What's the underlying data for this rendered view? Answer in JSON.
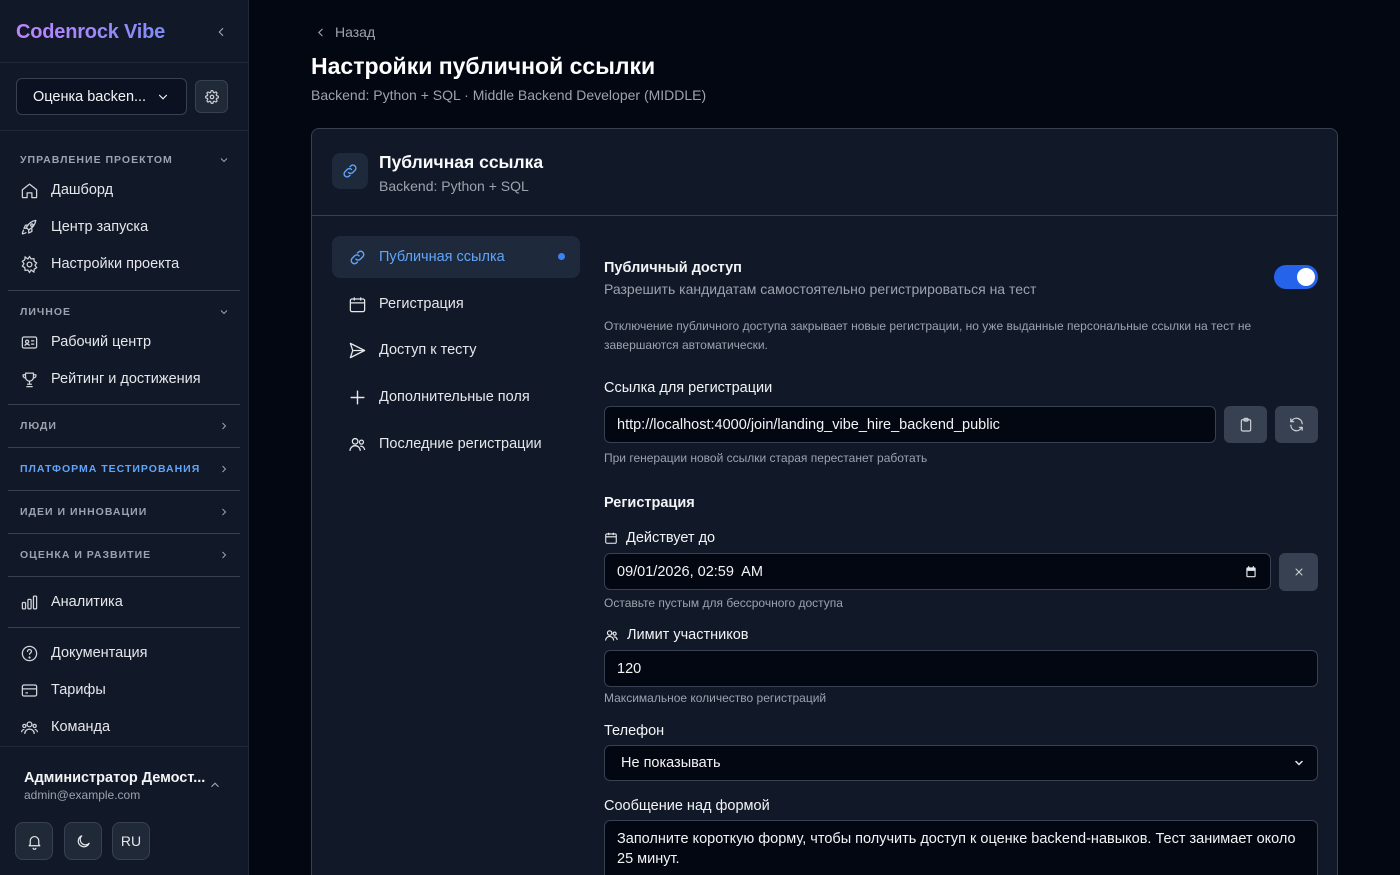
{
  "app": {
    "brand": "Codenrock Vibe"
  },
  "project_selector": {
    "value": "Оценка backen..."
  },
  "sidebar": {
    "section_project": "УПРАВЛЕНИЕ ПРОЕКТОМ",
    "project_items": [
      {
        "label": "Дашборд",
        "icon": "home-icon"
      },
      {
        "label": "Центр запуска",
        "icon": "rocket-icon"
      },
      {
        "label": "Настройки проекта",
        "icon": "gear-icon"
      }
    ],
    "section_personal": "ЛИЧНОЕ",
    "personal_items": [
      {
        "label": "Рабочий центр",
        "icon": "id-card-icon"
      },
      {
        "label": "Рейтинг и достижения",
        "icon": "trophy-icon"
      }
    ],
    "section_people": "ЛЮДИ",
    "section_testing": "ПЛАТФОРМА ТЕСТИРОВАНИЯ",
    "section_ideas": "ИДЕИ И ИННОВАЦИИ",
    "section_assessment": "ОЦЕНКА И РАЗВИТИЕ",
    "analytics": "Аналитика",
    "bottom_items": [
      {
        "label": "Документация",
        "icon": "help-circle-icon"
      },
      {
        "label": "Тарифы",
        "icon": "credit-card-icon"
      },
      {
        "label": "Команда",
        "icon": "users-icon"
      }
    ],
    "active_section_color": "#60a5fa"
  },
  "user": {
    "name": "Администратор Демост...",
    "email": "admin@example.com"
  },
  "footer_buttons": {
    "lang": "RU"
  },
  "header": {
    "back": "Назад",
    "title": "Настройки публичной ссылки",
    "subtitle": "Backend: Python + SQL · Middle Backend Developer (MIDDLE)"
  },
  "card": {
    "title": "Публичная ссылка",
    "subtitle": "Backend: Python + SQL"
  },
  "tabs": [
    {
      "label": "Публичная ссылка",
      "icon": "link-icon",
      "active": true
    },
    {
      "label": "Регистрация",
      "icon": "calendar-icon",
      "active": false
    },
    {
      "label": "Доступ к тесту",
      "icon": "send-icon",
      "active": false
    },
    {
      "label": "Дополнительные поля",
      "icon": "plus-icon",
      "active": false
    },
    {
      "label": "Последние регистрации",
      "icon": "users-icon",
      "active": false
    }
  ],
  "form": {
    "public_access_label": "Публичный доступ",
    "public_access_desc": "Разрешить кандидатам самостоятельно регистрироваться на тест",
    "public_access_enabled": true,
    "public_access_note": "Отключение публичного доступа закрывает новые регистрации, но уже выданные персональные ссылки на тест не завершаются автоматически.",
    "link_label": "Ссылка для регистрации",
    "link_value": "http://localhost:4000/join/landing_vibe_hire_backend_public",
    "link_hint": "При генерации новой ссылки старая перестанет работать",
    "registration_heading": "Регистрация",
    "valid_until_label": "Действует до",
    "valid_until_value": "09/01/2026, 02:59  AM",
    "valid_until_hint": "Оставьте пустым для бессрочного доступа",
    "limit_label": "Лимит участников",
    "limit_value": "120",
    "limit_hint": "Максимальное количество регистраций",
    "phone_label": "Телефон",
    "phone_value": "Не показывать",
    "message_label": "Сообщение над формой",
    "message_value": "Заполните короткую форму, чтобы получить доступ к оценке backend-навыков. Тест занимает около 25 минут."
  },
  "colors": {
    "accent": "#2563eb",
    "background": "#030712",
    "panel": "#111827"
  }
}
